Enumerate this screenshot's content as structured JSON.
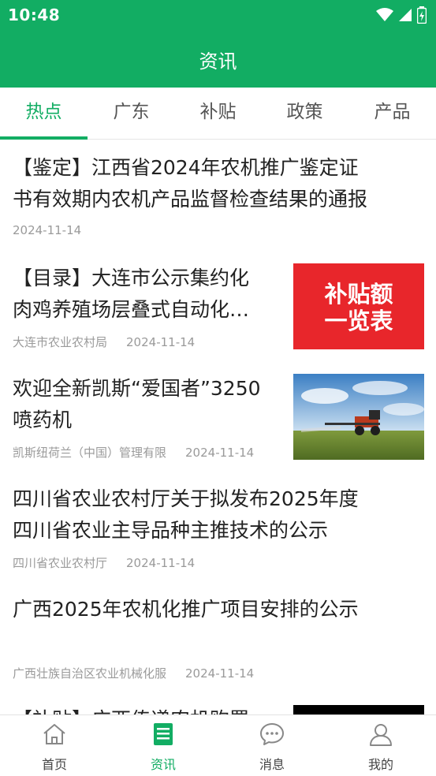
{
  "status_bar": {
    "time": "10:48"
  },
  "header": {
    "title": "资讯"
  },
  "tabs": [
    {
      "label": "热点",
      "active": true
    },
    {
      "label": "广东",
      "active": false
    },
    {
      "label": "补贴",
      "active": false
    },
    {
      "label": "政策",
      "active": false
    },
    {
      "label": "产品",
      "active": false
    }
  ],
  "news": [
    {
      "title_line1": "【鉴定】江西省2024年农机推广鉴定证",
      "title_line2": "书有效期内农机产品监督检查结果的通报",
      "source": "",
      "date": "2024-11-14"
    },
    {
      "title_line1": "【目录】大连市公示集约化",
      "title_line2": "肉鸡养殖场层叠式自动化…",
      "source": "大连市农业农村局",
      "date": "2024-11-14",
      "thumb_line1": "补贴额",
      "thumb_line2": "一览表"
    },
    {
      "title_line1": "欢迎全新凯斯“爱国者”3250",
      "title_line2": "喷药机",
      "source": "凯斯纽荷兰（中国）管理有限",
      "date": "2024-11-14"
    },
    {
      "title_line1": "四川省农业农村厅关于拟发布2025年度",
      "title_line2": "四川省农业主导品种主推技术的公示",
      "source": "四川省农业农村厅",
      "date": "2024-11-14"
    },
    {
      "title_line1": "广西2025年农机化推广项目安排的公示",
      "title_line2": "",
      "source": "广西壮族自治区农业机械化服",
      "date": "2024-11-14"
    },
    {
      "title_line1": "【补贴】广西传递农机购置"
    }
  ],
  "bottom_nav": [
    {
      "label": "首页",
      "icon": "home-icon",
      "active": false
    },
    {
      "label": "资讯",
      "icon": "news-icon",
      "active": true
    },
    {
      "label": "消息",
      "icon": "message-icon",
      "active": false
    },
    {
      "label": "我的",
      "icon": "user-icon",
      "active": false
    }
  ],
  "colors": {
    "brand": "#12ad63",
    "thumb_red": "#e8262b"
  }
}
